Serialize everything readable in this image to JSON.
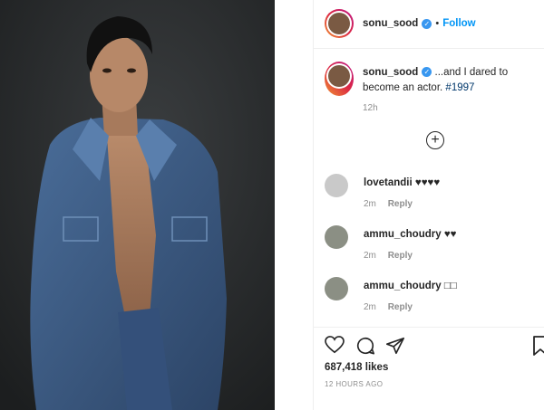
{
  "post": {
    "username": "sonu_sood",
    "follow_label": "Follow",
    "separator": "•",
    "caption": {
      "username": "sonu_sood",
      "text": " ...and I dared to become an actor. ",
      "hashtag": "#1997",
      "time": "12h"
    },
    "load_more_icon": "plus-circle-icon",
    "comments": [
      {
        "username": "lovetandii",
        "text": "♥♥♥♥",
        "time": "2m",
        "reply_label": "Reply"
      },
      {
        "username": "ammu_choudry",
        "text": "♥♥",
        "time": "2m",
        "reply_label": "Reply"
      },
      {
        "username": "ammu_choudry",
        "text": "□□",
        "time": "2m",
        "reply_label": "Reply"
      }
    ],
    "likes": "687,418 likes",
    "posted_ago": "12 HOURS AGO"
  },
  "colors": {
    "accent": "#0095f6",
    "verified": "#3897f0",
    "photo_bg": "#2a2c2d",
    "denim": "#3d5a80"
  }
}
